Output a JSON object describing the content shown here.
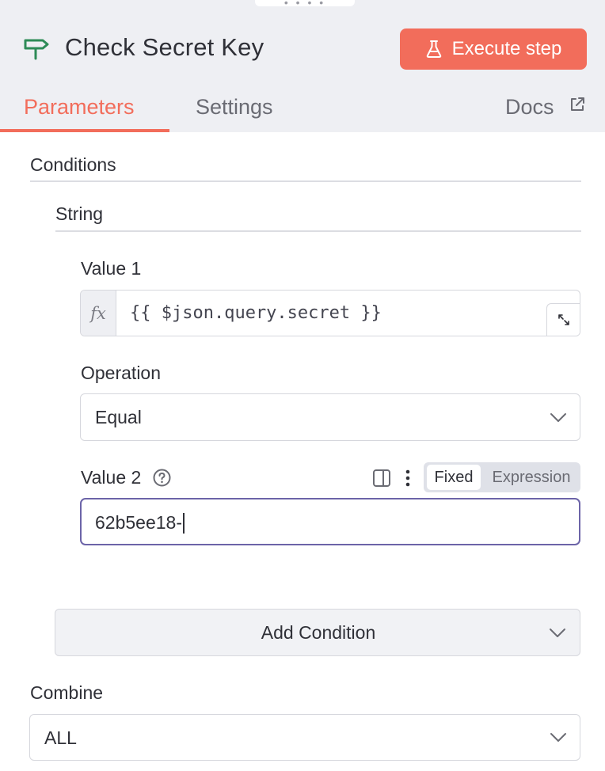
{
  "header": {
    "node_title": "Check Secret Key",
    "execute_label": "Execute step",
    "accent_color": "#f26d5b",
    "node_icon": "signpost-icon"
  },
  "tabs": [
    {
      "label": "Parameters",
      "active": true
    },
    {
      "label": "Settings",
      "active": false
    }
  ],
  "docs_label": "Docs",
  "conditions": {
    "label": "Conditions",
    "string_label": "String",
    "value1": {
      "label": "Value 1",
      "fx_symbol": "fx",
      "expression": "{{ $json.query.secret }}"
    },
    "operation": {
      "label": "Operation",
      "selected": "Equal"
    },
    "value2": {
      "label": "Value 2",
      "mode_fixed": "Fixed",
      "mode_expression": "Expression",
      "active_mode": "Fixed",
      "value": "62b5ee18-"
    },
    "add_condition_label": "Add Condition"
  },
  "combine": {
    "label": "Combine",
    "selected": "ALL"
  }
}
